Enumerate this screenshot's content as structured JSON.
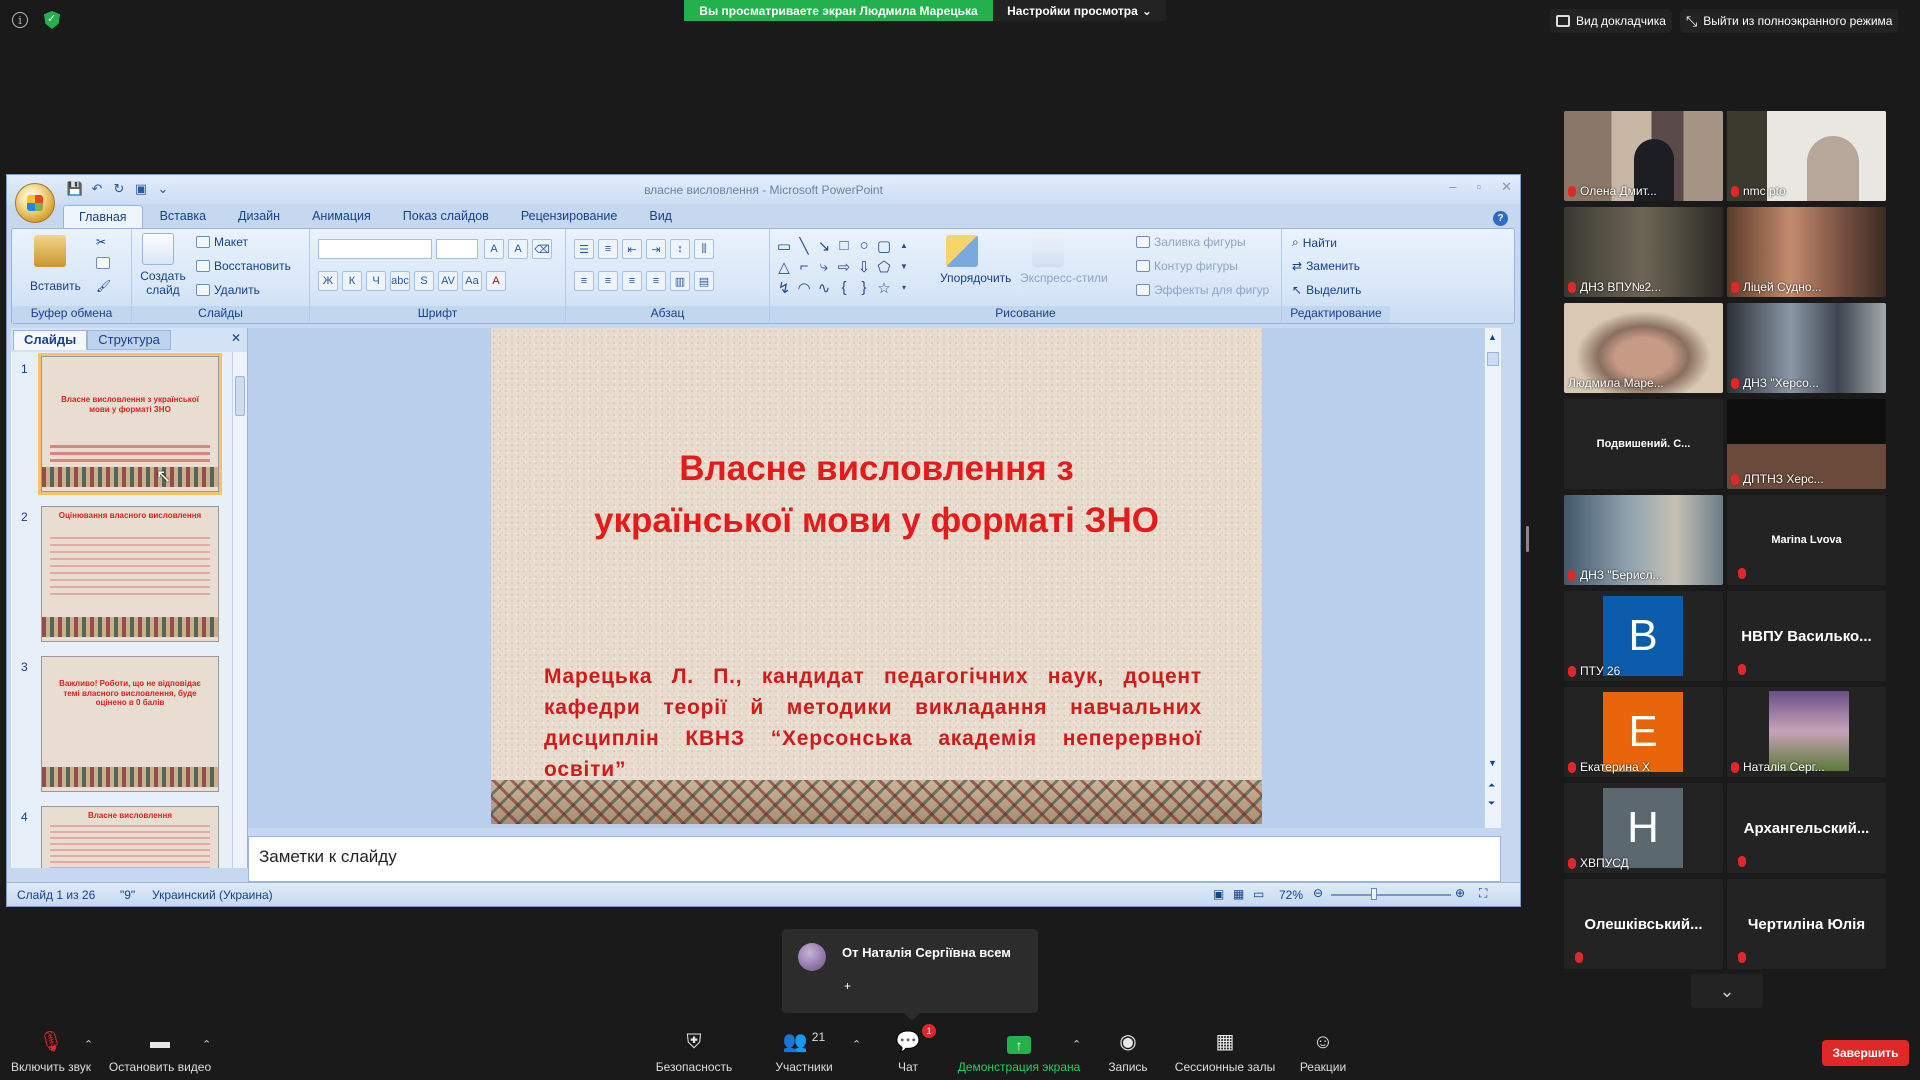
{
  "zoom": {
    "sharing_banner": "Вы просматриваете экран Людмила Марецька",
    "view_settings": "Настройки просмотра",
    "speaker_view": "Вид докладчика",
    "exit_fullscreen": "Выйти из полноэкранного режима",
    "end_button": "Завершить",
    "toolbar": {
      "unmute": "Включить звук",
      "stop_video": "Остановить видео",
      "security": "Безопасность",
      "participants": "Участники",
      "participants_count": "21",
      "chat": "Чат",
      "chat_badge": "1",
      "share_screen": "Демонстрация экрана",
      "record": "Запись",
      "breakout_rooms": "Сессионные залы",
      "reactions": "Реакции"
    },
    "chat_popup": {
      "from": "От Наталія Сергіївна всем",
      "message": "+"
    },
    "participants": [
      {
        "name": "Олена Дмит..."
      },
      {
        "name": "nmc pto"
      },
      {
        "name": "ДНЗ ВПУ№2..."
      },
      {
        "name": "Ліцей Судно..."
      },
      {
        "name": "Людмила Маре..."
      },
      {
        "name": "ДНЗ \"Херсо..."
      },
      {
        "name": "Подвишений. С..."
      },
      {
        "name": "ДПТНЗ Херс..."
      },
      {
        "name": "ДНЗ \"Берисл..."
      },
      {
        "name": "Marina Lvova"
      },
      {
        "name": "ПТУ 26",
        "letter": "B"
      },
      {
        "name": "НВПУ Василько..."
      },
      {
        "name": "Екатерина Х",
        "letter": "E"
      },
      {
        "name": "Наталія Серг..."
      },
      {
        "name": "ХВПУСД",
        "letter": "H"
      },
      {
        "name": "Архангельский..."
      },
      {
        "name": "Олешківський..."
      },
      {
        "name": "Чертиліна Юлія"
      }
    ],
    "colors": {
      "green": "#23b14d",
      "red": "#e02828",
      "avatar_blue": "#0b5cad",
      "avatar_orange": "#e8650b",
      "avatar_gray": "#5b6870"
    }
  },
  "ppt": {
    "window_title": "власне висловлення - Microsoft PowerPoint",
    "tabs": [
      "Главная",
      "Вставка",
      "Дизайн",
      "Анимация",
      "Показ слайдов",
      "Рецензирование",
      "Вид"
    ],
    "ribbon": {
      "paste": "Вставить",
      "clipboard_group": "Буфер обмена",
      "new_slide": "Создать слайд",
      "layout": "Макет",
      "reset": "Восстановить",
      "delete": "Удалить",
      "slides_group": "Слайды",
      "font_group": "Шрифт",
      "paragraph_group": "Абзац",
      "arrange": "Упорядочить",
      "quick_styles": "Экспресс-стили",
      "shape_fill": "Заливка фигуры",
      "shape_outline": "Контур фигуры",
      "shape_effects": "Эффекты для фигур",
      "drawing_group": "Рисование",
      "find": "Найти",
      "replace": "Заменить",
      "select": "Выделить",
      "editing_group": "Редактирование",
      "bold": "Ж",
      "italic": "К",
      "underline": "Ч",
      "strike": "abc",
      "shadow": "S",
      "spacing": "AV",
      "case": "Aa",
      "grow": "A",
      "shrink": "A"
    },
    "pane": {
      "slides_tab": "Слайды",
      "outline_tab": "Структура",
      "thumbs": [
        {
          "num": "1",
          "title": "Власне висловлення з української мови у форматі ЗНО"
        },
        {
          "num": "2",
          "title": "Оцінювання власного висловлення"
        },
        {
          "num": "3",
          "title": "Важливо! Роботи, що не відповідає темі власного висловлення, буде оцінено в 0 балів"
        },
        {
          "num": "4",
          "title": "Власне висловлення"
        }
      ]
    },
    "slide": {
      "title_line1": "Власне висловлення з",
      "title_line2": "української мови у форматі ЗНО",
      "subtitle": "Марецька Л. П., кандидат педагогічних наук, доцент кафедри теорії й методики  викладання навчальних дисциплін КВНЗ “Херсонська академія неперервної освіти”"
    },
    "notes_placeholder": "Заметки к слайду",
    "status": {
      "slide_of": "Слайд 1 из 26",
      "theme": "\"9\"",
      "language": "Украинский (Украина)",
      "zoom": "72%"
    }
  }
}
